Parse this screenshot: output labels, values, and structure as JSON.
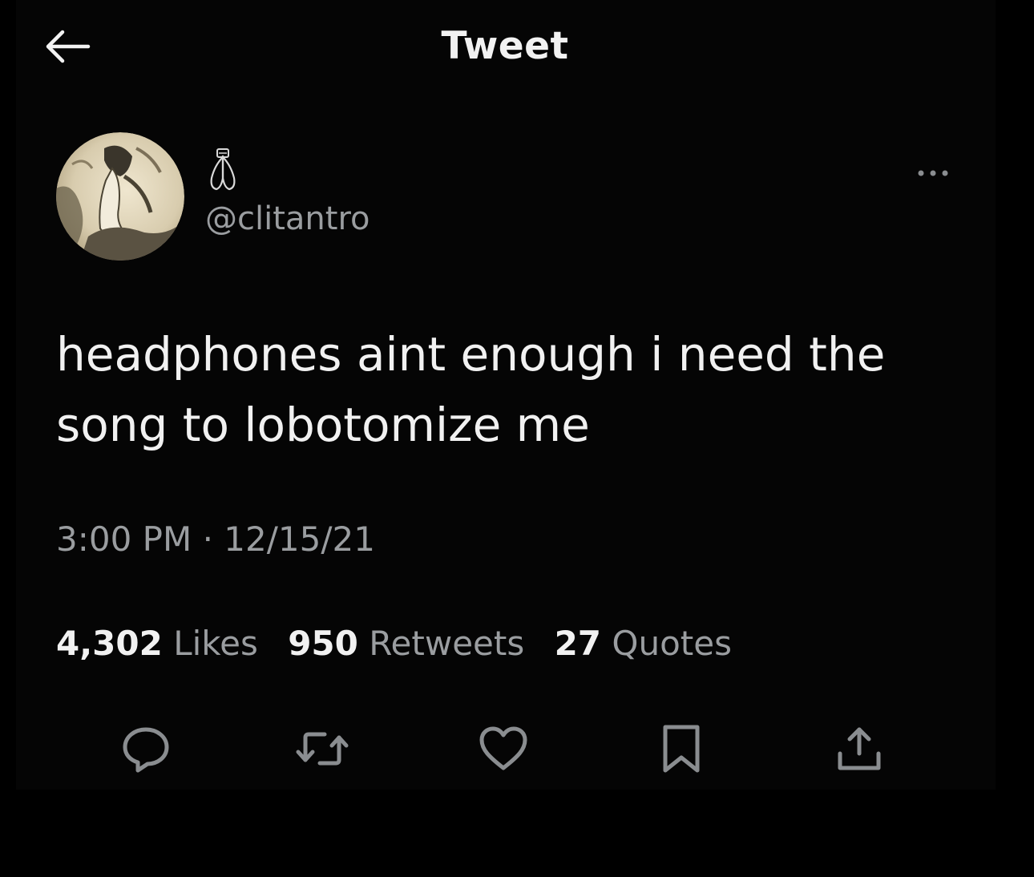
{
  "header": {
    "title": "Tweet"
  },
  "author": {
    "display_name_icon": "folded-hands-emoji-icon",
    "handle": "@clitantro"
  },
  "tweet": {
    "text": "headphones aint enough i need the song to lobotomize me",
    "time": "3:00 PM",
    "separator": " · ",
    "date": "12/15/21"
  },
  "stats": {
    "likes_count": "4,302",
    "likes_label": "Likes",
    "retweets_count": "950",
    "retweets_label": "Retweets",
    "quotes_count": "27",
    "quotes_label": "Quotes"
  },
  "actions": {
    "reply_icon": "reply-icon",
    "retweet_icon": "retweet-icon",
    "like_icon": "heart-icon",
    "bookmark_icon": "bookmark-icon",
    "share_icon": "share-icon"
  },
  "colors": {
    "background": "#000000",
    "primary_text": "#f1f1f1",
    "secondary_text": "#9a9da0"
  }
}
